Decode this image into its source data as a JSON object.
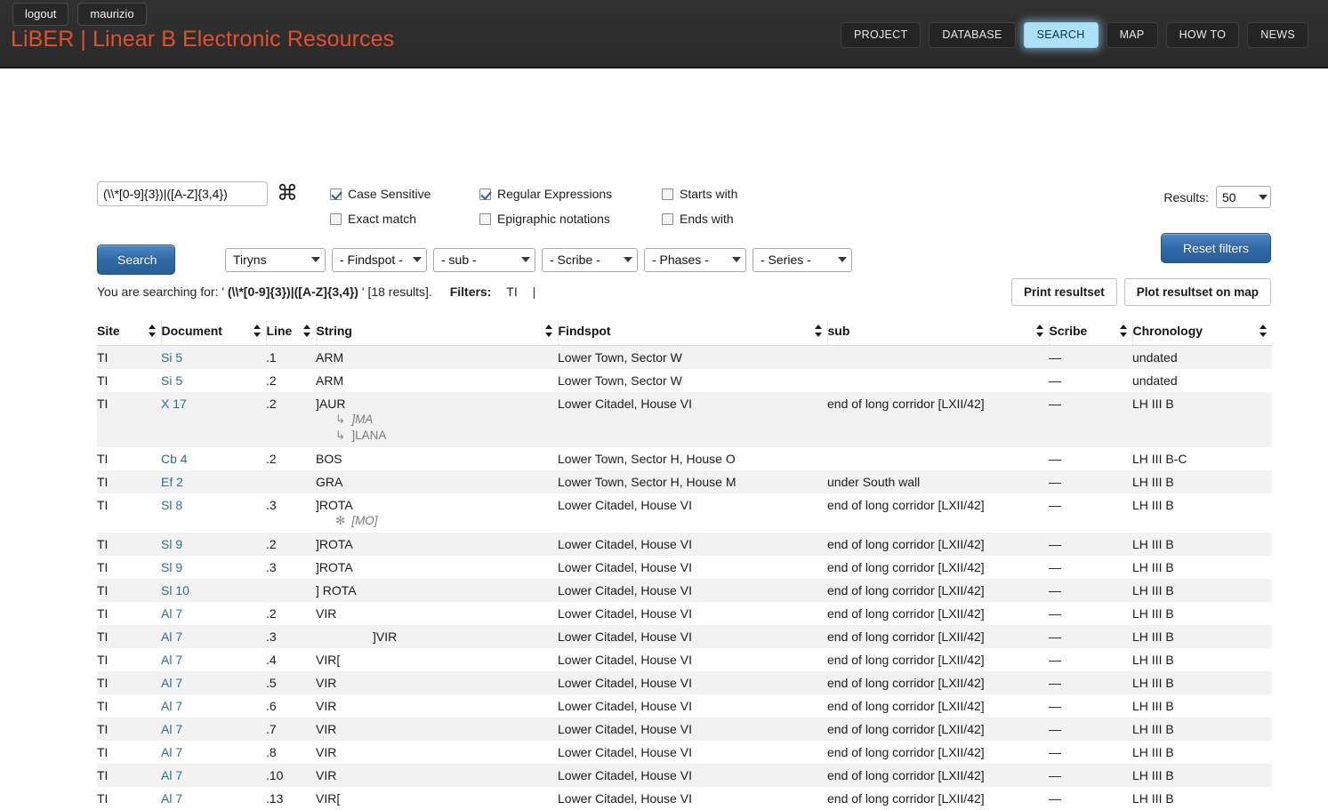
{
  "header": {
    "user_buttons": [
      {
        "label": "logout",
        "name": "logout-button"
      },
      {
        "label": "maurizio",
        "name": "username-button"
      }
    ],
    "brand": "LiBER | Linear B Electronic Resources",
    "brand_color": "#e0522d",
    "nav": [
      {
        "label": "PROJECT",
        "active": false
      },
      {
        "label": "DATABASE",
        "active": false
      },
      {
        "label": "SEARCH",
        "active": true
      },
      {
        "label": "MAP",
        "active": false
      },
      {
        "label": "HOW TO",
        "active": false
      },
      {
        "label": "NEWS",
        "active": false
      }
    ],
    "nav_active_color": "#ade0fb"
  },
  "search": {
    "query_value": "(\\\\*[0-9]{3})|([A-Z]{3,4})",
    "query_placeholder": "",
    "command_icon": "⌘",
    "search_button": "Search",
    "reset_button": "Reset filters",
    "results_label": "Results:",
    "results_value": "50",
    "checkboxes": [
      {
        "label": "Case Sensitive",
        "checked": true,
        "name": "checkbox-case-sensitive"
      },
      {
        "label": "Regular Expressions",
        "checked": true,
        "name": "checkbox-regular-expressions"
      },
      {
        "label": "Starts with",
        "checked": false,
        "name": "checkbox-starts-with"
      },
      {
        "label": "Exact match",
        "checked": false,
        "name": "checkbox-exact-match"
      },
      {
        "label": "Epigraphic notations",
        "checked": false,
        "name": "checkbox-epigraphic-notations"
      },
      {
        "label": "Ends with",
        "checked": false,
        "name": "checkbox-ends-with"
      }
    ],
    "filters": [
      {
        "value": "Tiryns",
        "name": "filter-site"
      },
      {
        "value": "- Findspot -",
        "name": "filter-findspot"
      },
      {
        "value": "- sub -",
        "name": "filter-sub"
      },
      {
        "value": "- Scribe -",
        "name": "filter-scribe"
      },
      {
        "value": "- Phases -",
        "name": "filter-phases"
      },
      {
        "value": "- Series -",
        "name": "filter-series"
      }
    ]
  },
  "summary": {
    "prefix": "You are searching for: '",
    "query": "(\\\\*[0-9]{3})|([A-Z]{3,4})",
    "suffix": "'",
    "count": "[18 results].",
    "filters_label": "Filters:",
    "filters_value": "TI",
    "filters_pipe": "|"
  },
  "actions": {
    "print": "Print resultset",
    "plot": "Plot resultset on map"
  },
  "table": {
    "columns": [
      "Site",
      "Document",
      "Line",
      "String",
      "Findspot",
      "sub",
      "Scribe",
      "Chronology"
    ],
    "rows": [
      {
        "site": "TI",
        "document": "Si 5",
        "line": ".1",
        "string": "ARM",
        "findspot": "Lower Town, Sector W",
        "sub": "",
        "scribe": "—",
        "chronology": "undated",
        "alt": true,
        "sublines": []
      },
      {
        "site": "TI",
        "document": "Si 5",
        "line": ".2",
        "string": "ARM",
        "findspot": "Lower Town, Sector W",
        "sub": "",
        "scribe": "—",
        "chronology": "undated",
        "alt": false,
        "sublines": []
      },
      {
        "site": "TI",
        "document": "X 17",
        "line": ".2",
        "string": "]AUR",
        "findspot": "Lower Citadel, House VI",
        "sub": "end of long corridor [LXII/42]",
        "scribe": "—",
        "chronology": "LH III B",
        "alt": true,
        "sublines": [
          {
            "marker": "↳",
            "text": "]MA",
            "italic": true
          },
          {
            "marker": "↳",
            "text": "]LANA",
            "italic": false
          }
        ]
      },
      {
        "site": "TI",
        "document": "Cb 4",
        "line": ".2",
        "string": "BOS",
        "findspot": "Lower Town, Sector H, House O",
        "sub": "",
        "scribe": "—",
        "chronology": "LH III B-C",
        "alt": false,
        "sublines": []
      },
      {
        "site": "TI",
        "document": "Ef 2",
        "line": "",
        "string": "GRA",
        "findspot": "Lower Town, Sector H, House M",
        "sub": "under South wall",
        "scribe": "—",
        "chronology": "LH III B",
        "alt": true,
        "sublines": []
      },
      {
        "site": "TI",
        "document": "Sl 8",
        "line": ".3",
        "string": "]ROTA",
        "findspot": "Lower Citadel, House VI",
        "sub": "end of long corridor [LXII/42]",
        "scribe": "—",
        "chronology": "LH III B",
        "alt": false,
        "sublines": [
          {
            "marker": "✻",
            "text": "[MO]",
            "italic": true
          }
        ]
      },
      {
        "site": "TI",
        "document": "Sl 9",
        "line": ".2",
        "string": "]ROTA",
        "findspot": "Lower Citadel, House VI",
        "sub": "end of long corridor [LXII/42]",
        "scribe": "—",
        "chronology": "LH III B",
        "alt": true,
        "sublines": []
      },
      {
        "site": "TI",
        "document": "Sl 9",
        "line": ".3",
        "string": "]ROTA",
        "findspot": "Lower Citadel, House VI",
        "sub": "end of long corridor [LXII/42]",
        "scribe": "—",
        "chronology": "LH III B",
        "alt": false,
        "sublines": []
      },
      {
        "site": "TI",
        "document": "Sl 10",
        "line": "",
        "string": "] ROTA",
        "findspot": "Lower Citadel, House VI",
        "sub": "end of long corridor [LXII/42]",
        "scribe": "—",
        "chronology": "LH III B",
        "alt": true,
        "sublines": []
      },
      {
        "site": "TI",
        "document": "Al 7",
        "line": ".2",
        "string": "VIR",
        "findspot": "Lower Citadel, House VI",
        "sub": "end of long corridor [LXII/42]",
        "scribe": "—",
        "chronology": "LH III B",
        "alt": false,
        "sublines": []
      },
      {
        "site": "TI",
        "document": "Al 7",
        "line": ".3",
        "string": "]VIR",
        "findspot": "Lower Citadel, House VI",
        "sub": "end of long corridor [LXII/42]",
        "scribe": "—",
        "chronology": "LH III B",
        "alt": true,
        "indent": true,
        "sublines": []
      },
      {
        "site": "TI",
        "document": "Al 7",
        "line": ".4",
        "string": "VIR[",
        "findspot": "Lower Citadel, House VI",
        "sub": "end of long corridor [LXII/42]",
        "scribe": "—",
        "chronology": "LH III B",
        "alt": false,
        "sublines": []
      },
      {
        "site": "TI",
        "document": "Al 7",
        "line": ".5",
        "string": "VIR",
        "findspot": "Lower Citadel, House VI",
        "sub": "end of long corridor [LXII/42]",
        "scribe": "—",
        "chronology": "LH III B",
        "alt": true,
        "sublines": []
      },
      {
        "site": "TI",
        "document": "Al 7",
        "line": ".6",
        "string": "VIR",
        "findspot": "Lower Citadel, House VI",
        "sub": "end of long corridor [LXII/42]",
        "scribe": "—",
        "chronology": "LH III B",
        "alt": false,
        "sublines": []
      },
      {
        "site": "TI",
        "document": "Al 7",
        "line": ".7",
        "string": "VIR",
        "findspot": "Lower Citadel, House VI",
        "sub": "end of long corridor [LXII/42]",
        "scribe": "—",
        "chronology": "LH III B",
        "alt": true,
        "sublines": []
      },
      {
        "site": "TI",
        "document": "Al 7",
        "line": ".8",
        "string": "VIR",
        "findspot": "Lower Citadel, House VI",
        "sub": "end of long corridor [LXII/42]",
        "scribe": "—",
        "chronology": "LH III B",
        "alt": false,
        "sublines": []
      },
      {
        "site": "TI",
        "document": "Al 7",
        "line": ".10",
        "string": "VIR",
        "findspot": "Lower Citadel, House VI",
        "sub": "end of long corridor [LXII/42]",
        "scribe": "—",
        "chronology": "LH III B",
        "alt": true,
        "sublines": []
      },
      {
        "site": "TI",
        "document": "Al 7",
        "line": ".13",
        "string": "VIR[",
        "findspot": "Lower Citadel, House VI",
        "sub": "end of long corridor [LXII/42]",
        "scribe": "—",
        "chronology": "LH III B",
        "alt": false,
        "sublines": []
      }
    ]
  }
}
